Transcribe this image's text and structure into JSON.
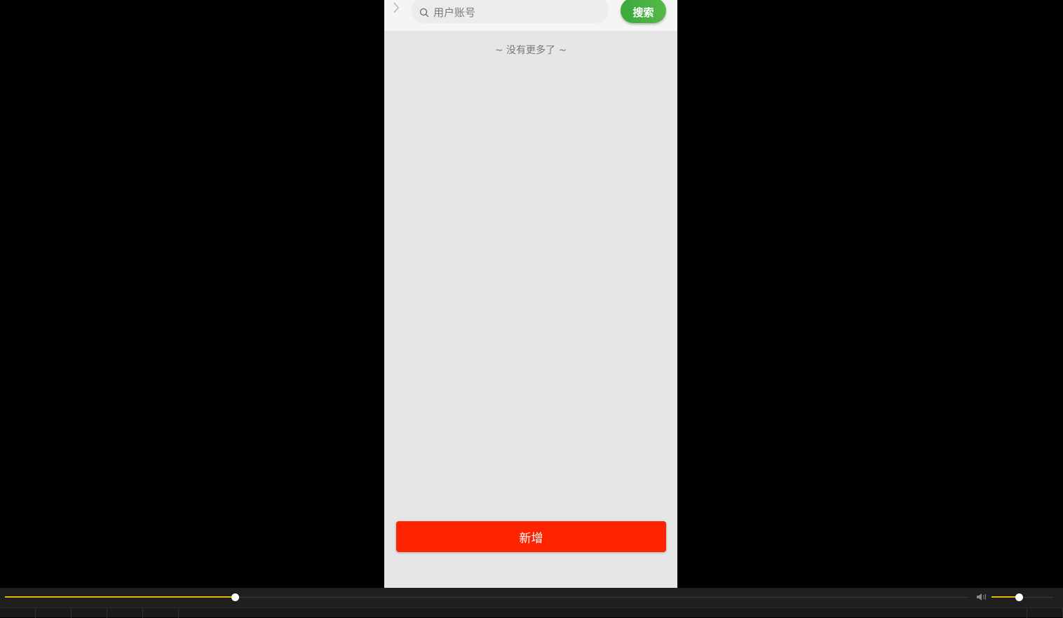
{
  "search": {
    "placeholder": "用户账号",
    "button_label": "搜索"
  },
  "list": {
    "empty_text": "~ 没有更多了 ~"
  },
  "footer": {
    "add_label": "新增"
  },
  "player": {
    "progress": 0.2385,
    "volume": 0.44
  },
  "colors": {
    "search_button": "#4caf50",
    "add_button": "#ff2400",
    "accent": "#e6b800"
  },
  "icons": {
    "back": "chevron-right-icon",
    "search": "search-icon",
    "volume": "volume-icon"
  }
}
